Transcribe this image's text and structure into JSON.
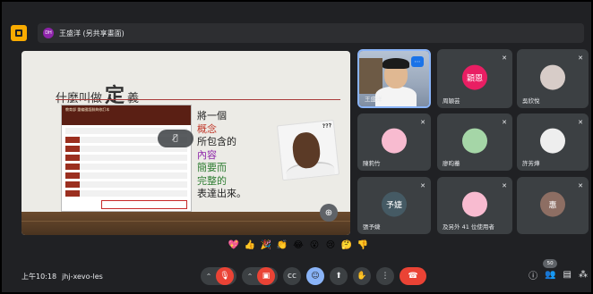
{
  "presenter": {
    "initials": "DH",
    "label": "王盛洋 (另共享畫面)"
  },
  "slide": {
    "title_prefix": "什麼叫做",
    "title_big": "定",
    "title_suffix": "義",
    "lines": [
      {
        "text": "將一個",
        "color": "normal"
      },
      {
        "text": "概念",
        "color": "red"
      },
      {
        "text": "所包含的",
        "color": "normal"
      },
      {
        "text": "內容",
        "color": "purple"
      },
      {
        "text": "簡要而",
        "color": "green"
      },
      {
        "text": "完整的",
        "color": "green"
      },
      {
        "text": "表達出來。",
        "color": "normal"
      }
    ],
    "face_card_text": "???",
    "mini_web_header": "教育部 重編國語辭典修訂本"
  },
  "participants": [
    {
      "name": "王盛洋",
      "type": "video",
      "initials": ""
    },
    {
      "name": "周穎芸",
      "type": "avatar",
      "initials": "穎恩",
      "color": "#e91e63"
    },
    {
      "name": "吳欣悅",
      "type": "avatar",
      "initials": "",
      "color": "#d7ccc8"
    },
    {
      "name": "陳莉竹",
      "type": "avatar",
      "initials": "",
      "color": "#f8bbd0"
    },
    {
      "name": "廖昀蓁",
      "type": "avatar",
      "initials": "",
      "color": "#a5d6a7"
    },
    {
      "name": "許芳燁",
      "type": "avatar",
      "initials": "",
      "color": "#eeeeee"
    },
    {
      "name": "張予婕",
      "type": "avatar",
      "initials": "予婕",
      "color": "#455a64"
    },
    {
      "name": "及另外 41 位使用者",
      "type": "avatar",
      "initials": "",
      "color": "#f8bbd0"
    },
    {
      "name": "",
      "type": "avatar",
      "initials": "惠",
      "color": "#8d6e63"
    }
  ],
  "reactions": [
    "💖",
    "👍",
    "🎉",
    "👏",
    "😂",
    "😮",
    "😢",
    "🤔",
    "👎"
  ],
  "meeting": {
    "time": "上午10:18",
    "code": "jhj-xevo-les"
  },
  "people_count": "50",
  "colors": {
    "background": "#202124",
    "tile": "#3c4043",
    "end_call": "#ea4335",
    "active_border": "#8ab4f8"
  }
}
